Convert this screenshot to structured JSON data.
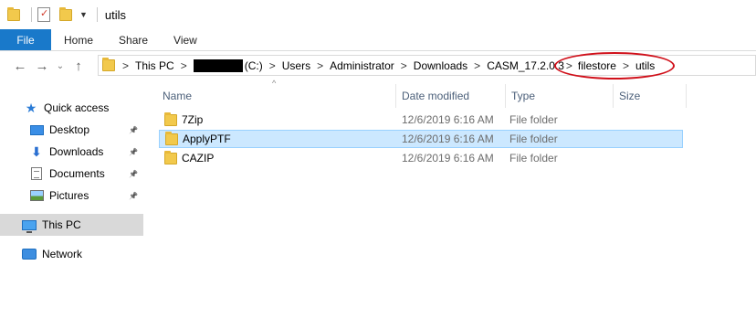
{
  "window": {
    "title": "utils",
    "icons": [
      "folder-icon",
      "properties-icon",
      "new-folder-icon",
      "customize-dropdown-icon"
    ]
  },
  "ribbon": {
    "tabs": [
      "File",
      "Home",
      "Share",
      "View"
    ]
  },
  "navigation": {
    "back_icon": "←",
    "forward_icon": "→",
    "recent_icon": "⌄",
    "up_icon": "↑",
    "separator": ">"
  },
  "address": {
    "crumbs": [
      "This PC",
      "(C:)",
      "Users",
      "Administrator",
      "Downloads",
      "CASM_17.2.0.3",
      "filestore",
      "utils"
    ]
  },
  "sidebar": {
    "items": [
      {
        "label": "Quick access",
        "icon": "quick-access-star-icon",
        "glyph": "★"
      },
      {
        "label": "Desktop",
        "icon": "desktop-icon",
        "pinned": true
      },
      {
        "label": "Downloads",
        "icon": "downloads-icon",
        "glyph": "⬇",
        "pinned": true
      },
      {
        "label": "Documents",
        "icon": "documents-icon",
        "pinned": true
      },
      {
        "label": "Pictures",
        "icon": "pictures-icon",
        "pinned": true
      },
      {
        "label": "This PC",
        "icon": "this-pc-icon",
        "selected": true
      },
      {
        "label": "Network",
        "icon": "network-icon"
      }
    ],
    "pin_glyph": "📌"
  },
  "file_list": {
    "columns": [
      "Name",
      "Date modified",
      "Type",
      "Size"
    ],
    "sort_glyph": "^",
    "rows": [
      {
        "name": "7Zip",
        "date": "12/6/2019 6:16 AM",
        "type": "File folder",
        "size": ""
      },
      {
        "name": "ApplyPTF",
        "date": "12/6/2019 6:16 AM",
        "type": "File folder",
        "size": "",
        "selected": true
      },
      {
        "name": "CAZIP",
        "date": "12/6/2019 6:16 AM",
        "type": "File folder",
        "size": ""
      }
    ]
  },
  "colors": {
    "accent": "#1979ca",
    "selection": "#cce8ff",
    "annotation": "#d0101a",
    "folder": "#f2c94c"
  }
}
